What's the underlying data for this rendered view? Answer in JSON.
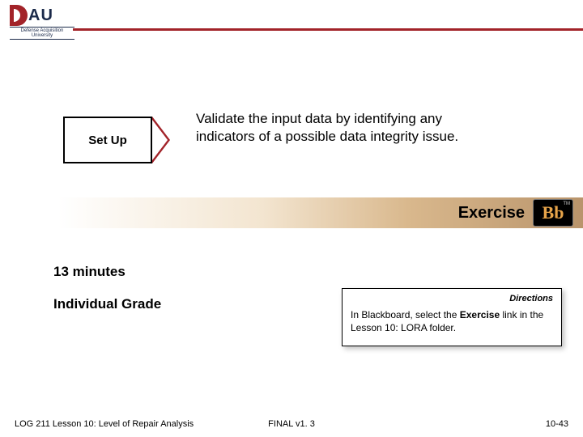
{
  "logo": {
    "text": "AU",
    "sub": "Defense Acquisition University"
  },
  "setup": {
    "label": "Set Up",
    "description": "Validate the input data by identifying any indicators of a possible data integrity issue."
  },
  "exercise": {
    "label": "Exercise",
    "badge": "Bb",
    "tm": "TM"
  },
  "time": "13 minutes",
  "grade": "Individual Grade",
  "directions": {
    "title": "Directions",
    "prefix": "In Blackboard, select the ",
    "bold": "Exercise",
    "suffix": " link in the Lesson 10: LORA folder."
  },
  "footer": {
    "left": "LOG 211 Lesson 10: Level of Repair Analysis",
    "center": "FINAL v1. 3",
    "right": "10-43"
  }
}
